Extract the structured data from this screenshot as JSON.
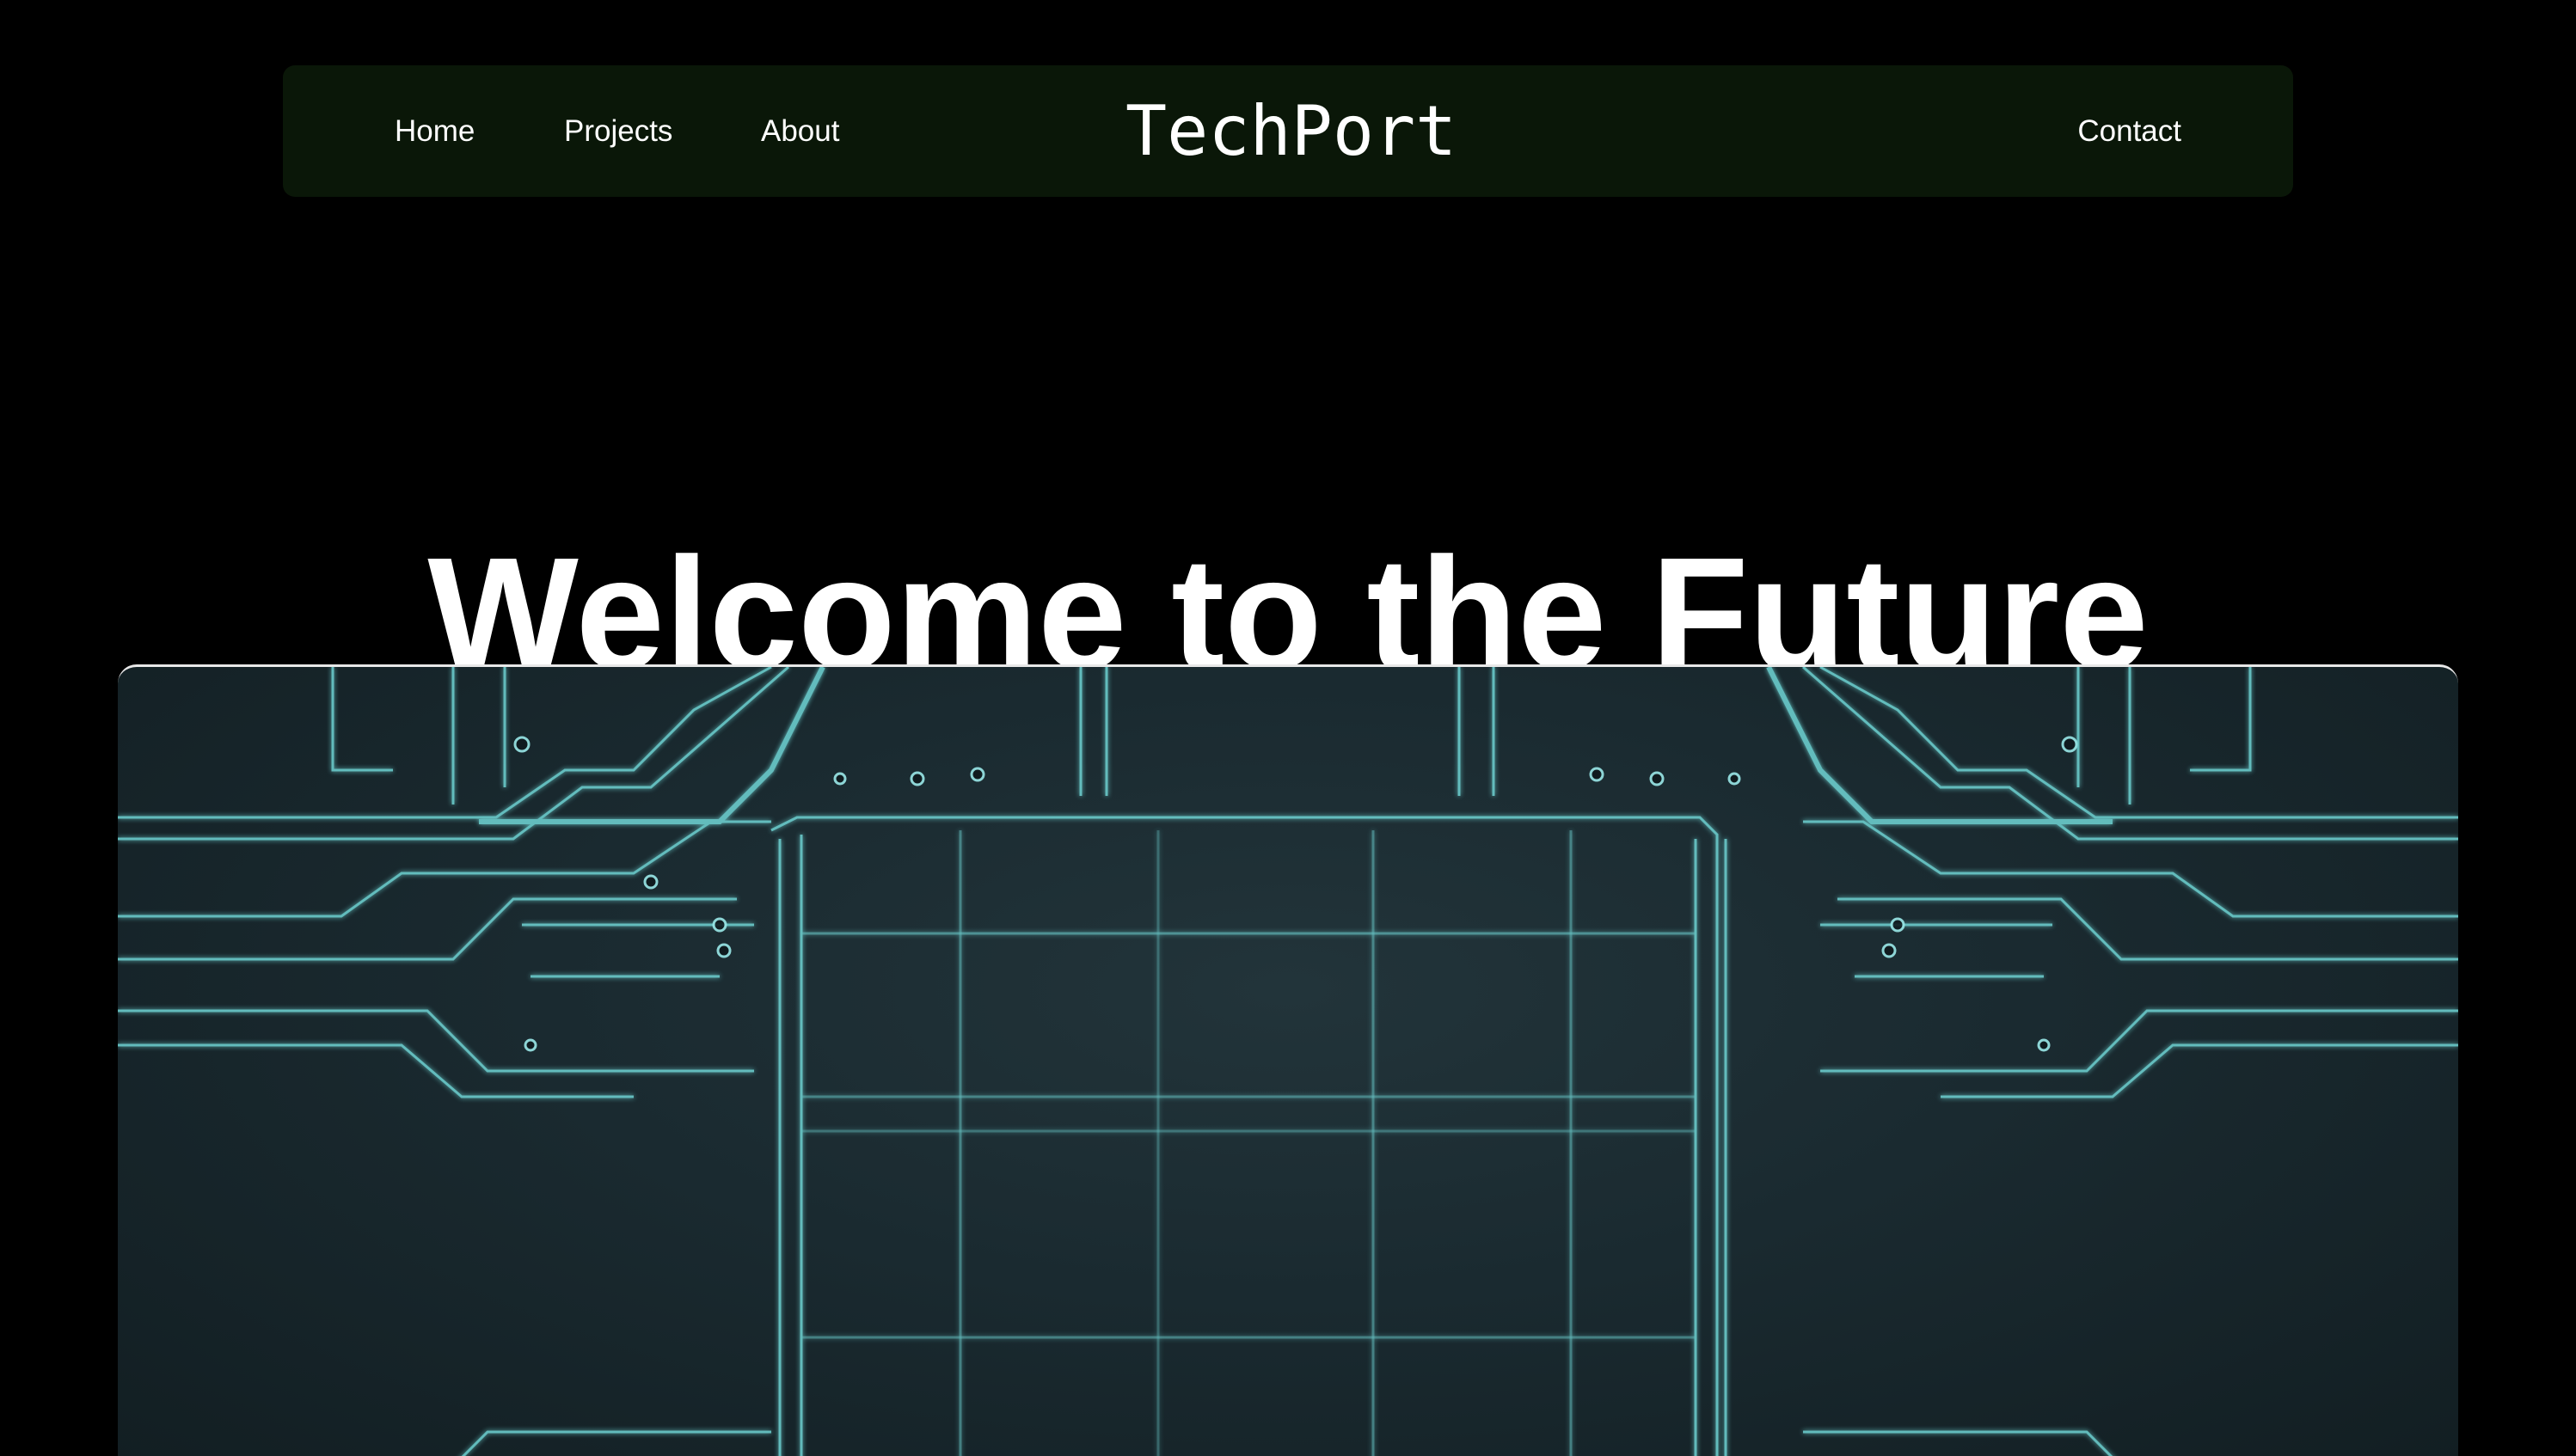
{
  "nav": {
    "home_label": "Home",
    "projects_label": "Projects",
    "about_label": "About",
    "brand": "TechPort",
    "contact_label": "Contact"
  },
  "hero": {
    "title": "Welcome to the Future",
    "image_icon": "circuit-board-image"
  },
  "colors": {
    "page_background": "#000000",
    "navbar_background": "#0a1708",
    "text": "#ffffff",
    "circuit_trace": "#6fd6d6",
    "board_background": "#1a2a30"
  }
}
